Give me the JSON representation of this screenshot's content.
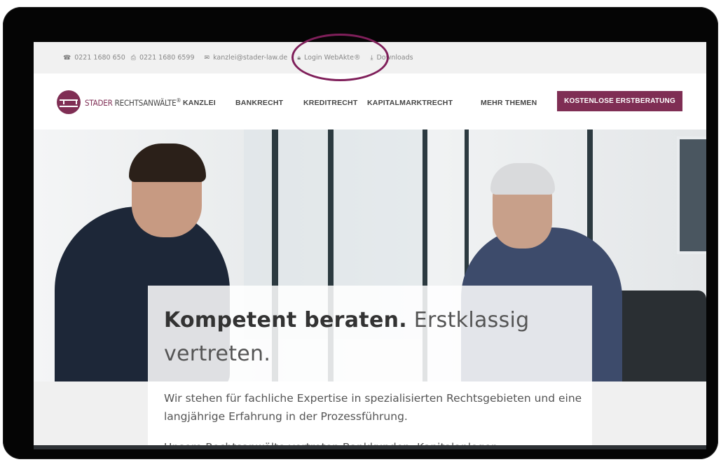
{
  "topbar": {
    "phone": "0221 1680 650",
    "fax": "0221 1680 6599",
    "email": "kanzlei@stader-law.de",
    "login": "Login WebAkte®",
    "downloads": "Downloads"
  },
  "brand": {
    "name_part1": "STADER",
    "name_part2": " RECHTSANWÄLTE",
    "reg": "®"
  },
  "nav": {
    "items": [
      "KANZLEI",
      "BANKRECHT",
      "KREDITRECHT",
      "KAPITALMARKTRECHT",
      "MEHR THEMEN"
    ],
    "cta": "KOSTENLOSE ERSTBERATUNG"
  },
  "hero": {
    "headline_bold": "Kompetent beraten.",
    "headline_light": " Erstklassig vertreten.",
    "lead": "Wir stehen für fachliche Expertise in spezialisierten Rechtsgebieten und eine langjährige Erfahrung in der Prozessführung.",
    "cut_text": "Unsere Rechtsanwälte vertreten Bankkunden, Kapitalanleger"
  },
  "colors": {
    "brand": "#7f2e54",
    "annotation": "#7f1f5a"
  }
}
